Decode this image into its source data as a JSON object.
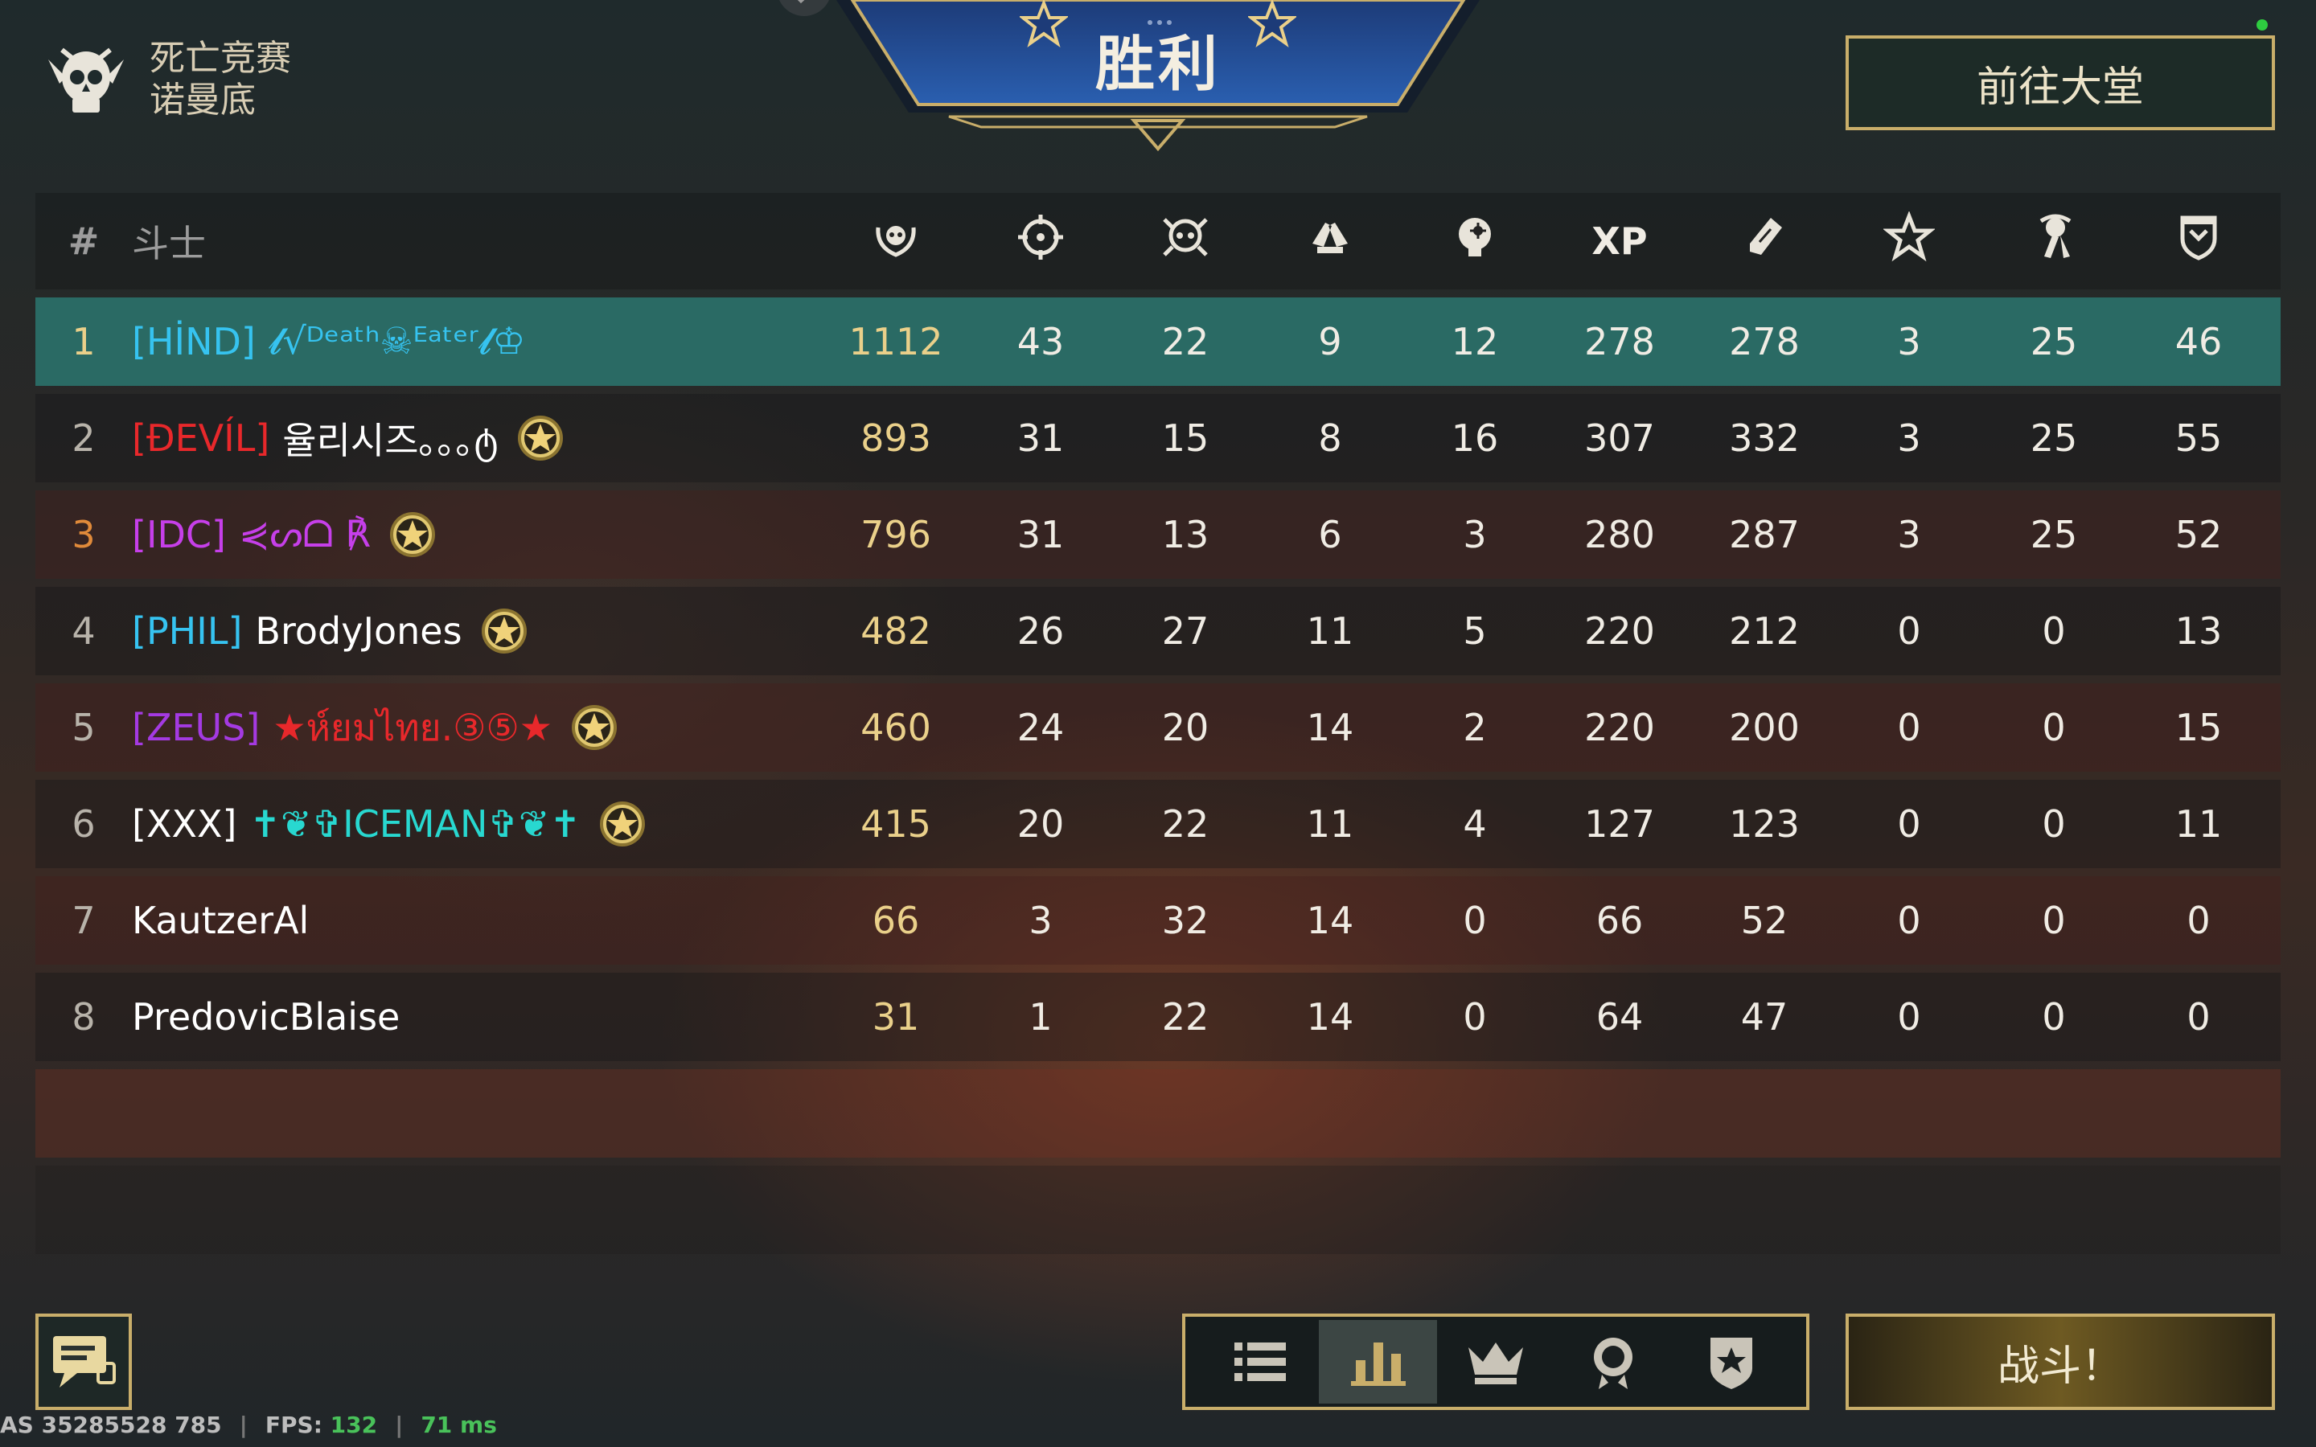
{
  "mode": {
    "line1": "死亡竞赛",
    "line2": "诺曼底"
  },
  "banner": {
    "title": "胜利"
  },
  "header_button": "前往大堂",
  "table": {
    "hash": "#",
    "name_header": "斗士",
    "columns": [
      {
        "icon": "score-wreath-icon"
      },
      {
        "icon": "crosshair-icon"
      },
      {
        "icon": "skull-icon"
      },
      {
        "icon": "assist-hands-icon"
      },
      {
        "icon": "headshot-icon"
      },
      {
        "label": "XP"
      },
      {
        "icon": "ticket-icon"
      },
      {
        "icon": "star-icon"
      },
      {
        "icon": "medal-icon"
      },
      {
        "icon": "shield-icon"
      }
    ],
    "rows": [
      {
        "rank": "1",
        "clan": "[HİND]",
        "clan_color": "#36c3f0",
        "name": "𝓵√ᴰᵉᵃᵗʰ☠ᴱᵃᵗᵉʳ𝓵♔",
        "name_color": "#36c3f0",
        "badge": false,
        "values": [
          "1112",
          "43",
          "22",
          "9",
          "12",
          "278",
          "278",
          "3",
          "25",
          "46"
        ]
      },
      {
        "rank": "2",
        "clan": "[ĐEVÍL]",
        "clan_color": "#e8282b",
        "name": "율리시즈｡｡｡ტ",
        "name_color": "#ffffff",
        "badge": true,
        "values": [
          "893",
          "31",
          "15",
          "8",
          "16",
          "307",
          "332",
          "3",
          "25",
          "55"
        ]
      },
      {
        "rank": "3",
        "clan": "[IDC]",
        "clan_color": "#c63fe9",
        "name": "⋞ᔕᗝ ℟",
        "name_color": "#c63fe9",
        "badge": true,
        "values": [
          "796",
          "31",
          "13",
          "6",
          "3",
          "280",
          "287",
          "3",
          "25",
          "52"
        ]
      },
      {
        "rank": "4",
        "clan": "[PHIL]",
        "clan_color": "#36c3f0",
        "name": "BrodyJones",
        "name_color": "#ffffff",
        "badge": true,
        "values": [
          "482",
          "26",
          "27",
          "11",
          "5",
          "220",
          "212",
          "0",
          "0",
          "13"
        ]
      },
      {
        "rank": "5",
        "clan": "[ZEUS]",
        "clan_color": "#a43ae2",
        "name": "★ห์ยมไทย.③⑤★",
        "name_color": "#e8282b",
        "badge": true,
        "values": [
          "460",
          "24",
          "20",
          "14",
          "2",
          "220",
          "200",
          "0",
          "0",
          "15"
        ]
      },
      {
        "rank": "6",
        "clan": "[XXX]",
        "clan_color": "#ffffff",
        "name": "✝❦✞ICEMAN✞❦✝",
        "name_color": "#28d8d0",
        "badge": true,
        "values": [
          "415",
          "20",
          "22",
          "11",
          "4",
          "127",
          "123",
          "0",
          "0",
          "11"
        ]
      },
      {
        "rank": "7",
        "clan": "",
        "clan_color": "#ffffff",
        "name": "KautzerAl",
        "name_color": "#ffffff",
        "badge": false,
        "values": [
          "66",
          "3",
          "32",
          "14",
          "0",
          "66",
          "52",
          "0",
          "0",
          "0"
        ]
      },
      {
        "rank": "8",
        "clan": "",
        "clan_color": "#ffffff",
        "name": "PredovicBlaise",
        "name_color": "#ffffff",
        "badge": false,
        "values": [
          "31",
          "1",
          "22",
          "14",
          "0",
          "64",
          "47",
          "0",
          "0",
          "0"
        ]
      }
    ],
    "rank_colors": {
      "1": "#ead08a",
      "3": "#e08a3a"
    }
  },
  "bottom": {
    "status": {
      "id": "AS 35285528 785",
      "fps_label": "FPS:",
      "fps": "132",
      "ping": "71 ms"
    },
    "nav": [
      {
        "icon": "list-icon",
        "active": false
      },
      {
        "icon": "bar-chart-icon",
        "active": true
      },
      {
        "icon": "crown-icon",
        "active": false
      },
      {
        "icon": "ribbon-medal-icon",
        "active": false
      },
      {
        "icon": "star-shield-icon",
        "active": false
      }
    ],
    "fight_button": "战斗！"
  },
  "colors": {
    "accent_gold": "#c9ae6a",
    "winner_row": "#2a6a64",
    "score": "#ead08a"
  }
}
